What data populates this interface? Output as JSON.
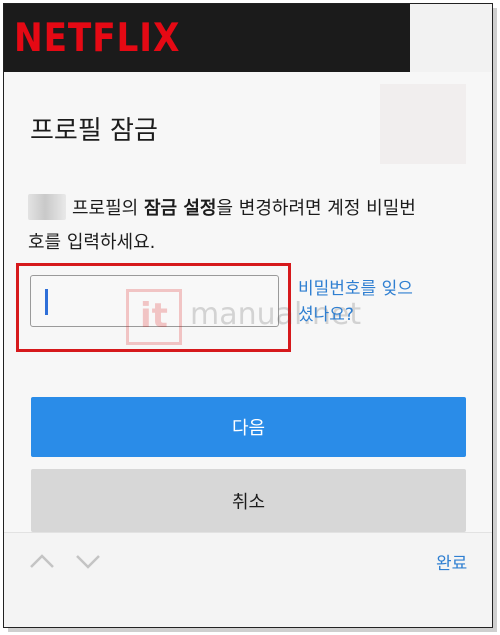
{
  "header": {
    "brand": "NETFLIX"
  },
  "dialog": {
    "title": "프로필 잠금",
    "message_prefix": "프로필의 ",
    "message_bold": "잠금 설정",
    "message_suffix": "을 변경하려면 계정 비밀번호를 입력하세요.",
    "password_value": "",
    "forgot_link": "비밀번호를 잊으셨나요?",
    "next_label": "다음",
    "cancel_label": "취소"
  },
  "watermark": {
    "logo": "it",
    "text": "manual.net"
  },
  "keyboard_bar": {
    "done_label": "완료"
  },
  "colors": {
    "brand_red": "#e50914",
    "primary_blue": "#2a8ce8",
    "link_blue": "#2f7fd1",
    "highlight_red": "#d6191c"
  }
}
